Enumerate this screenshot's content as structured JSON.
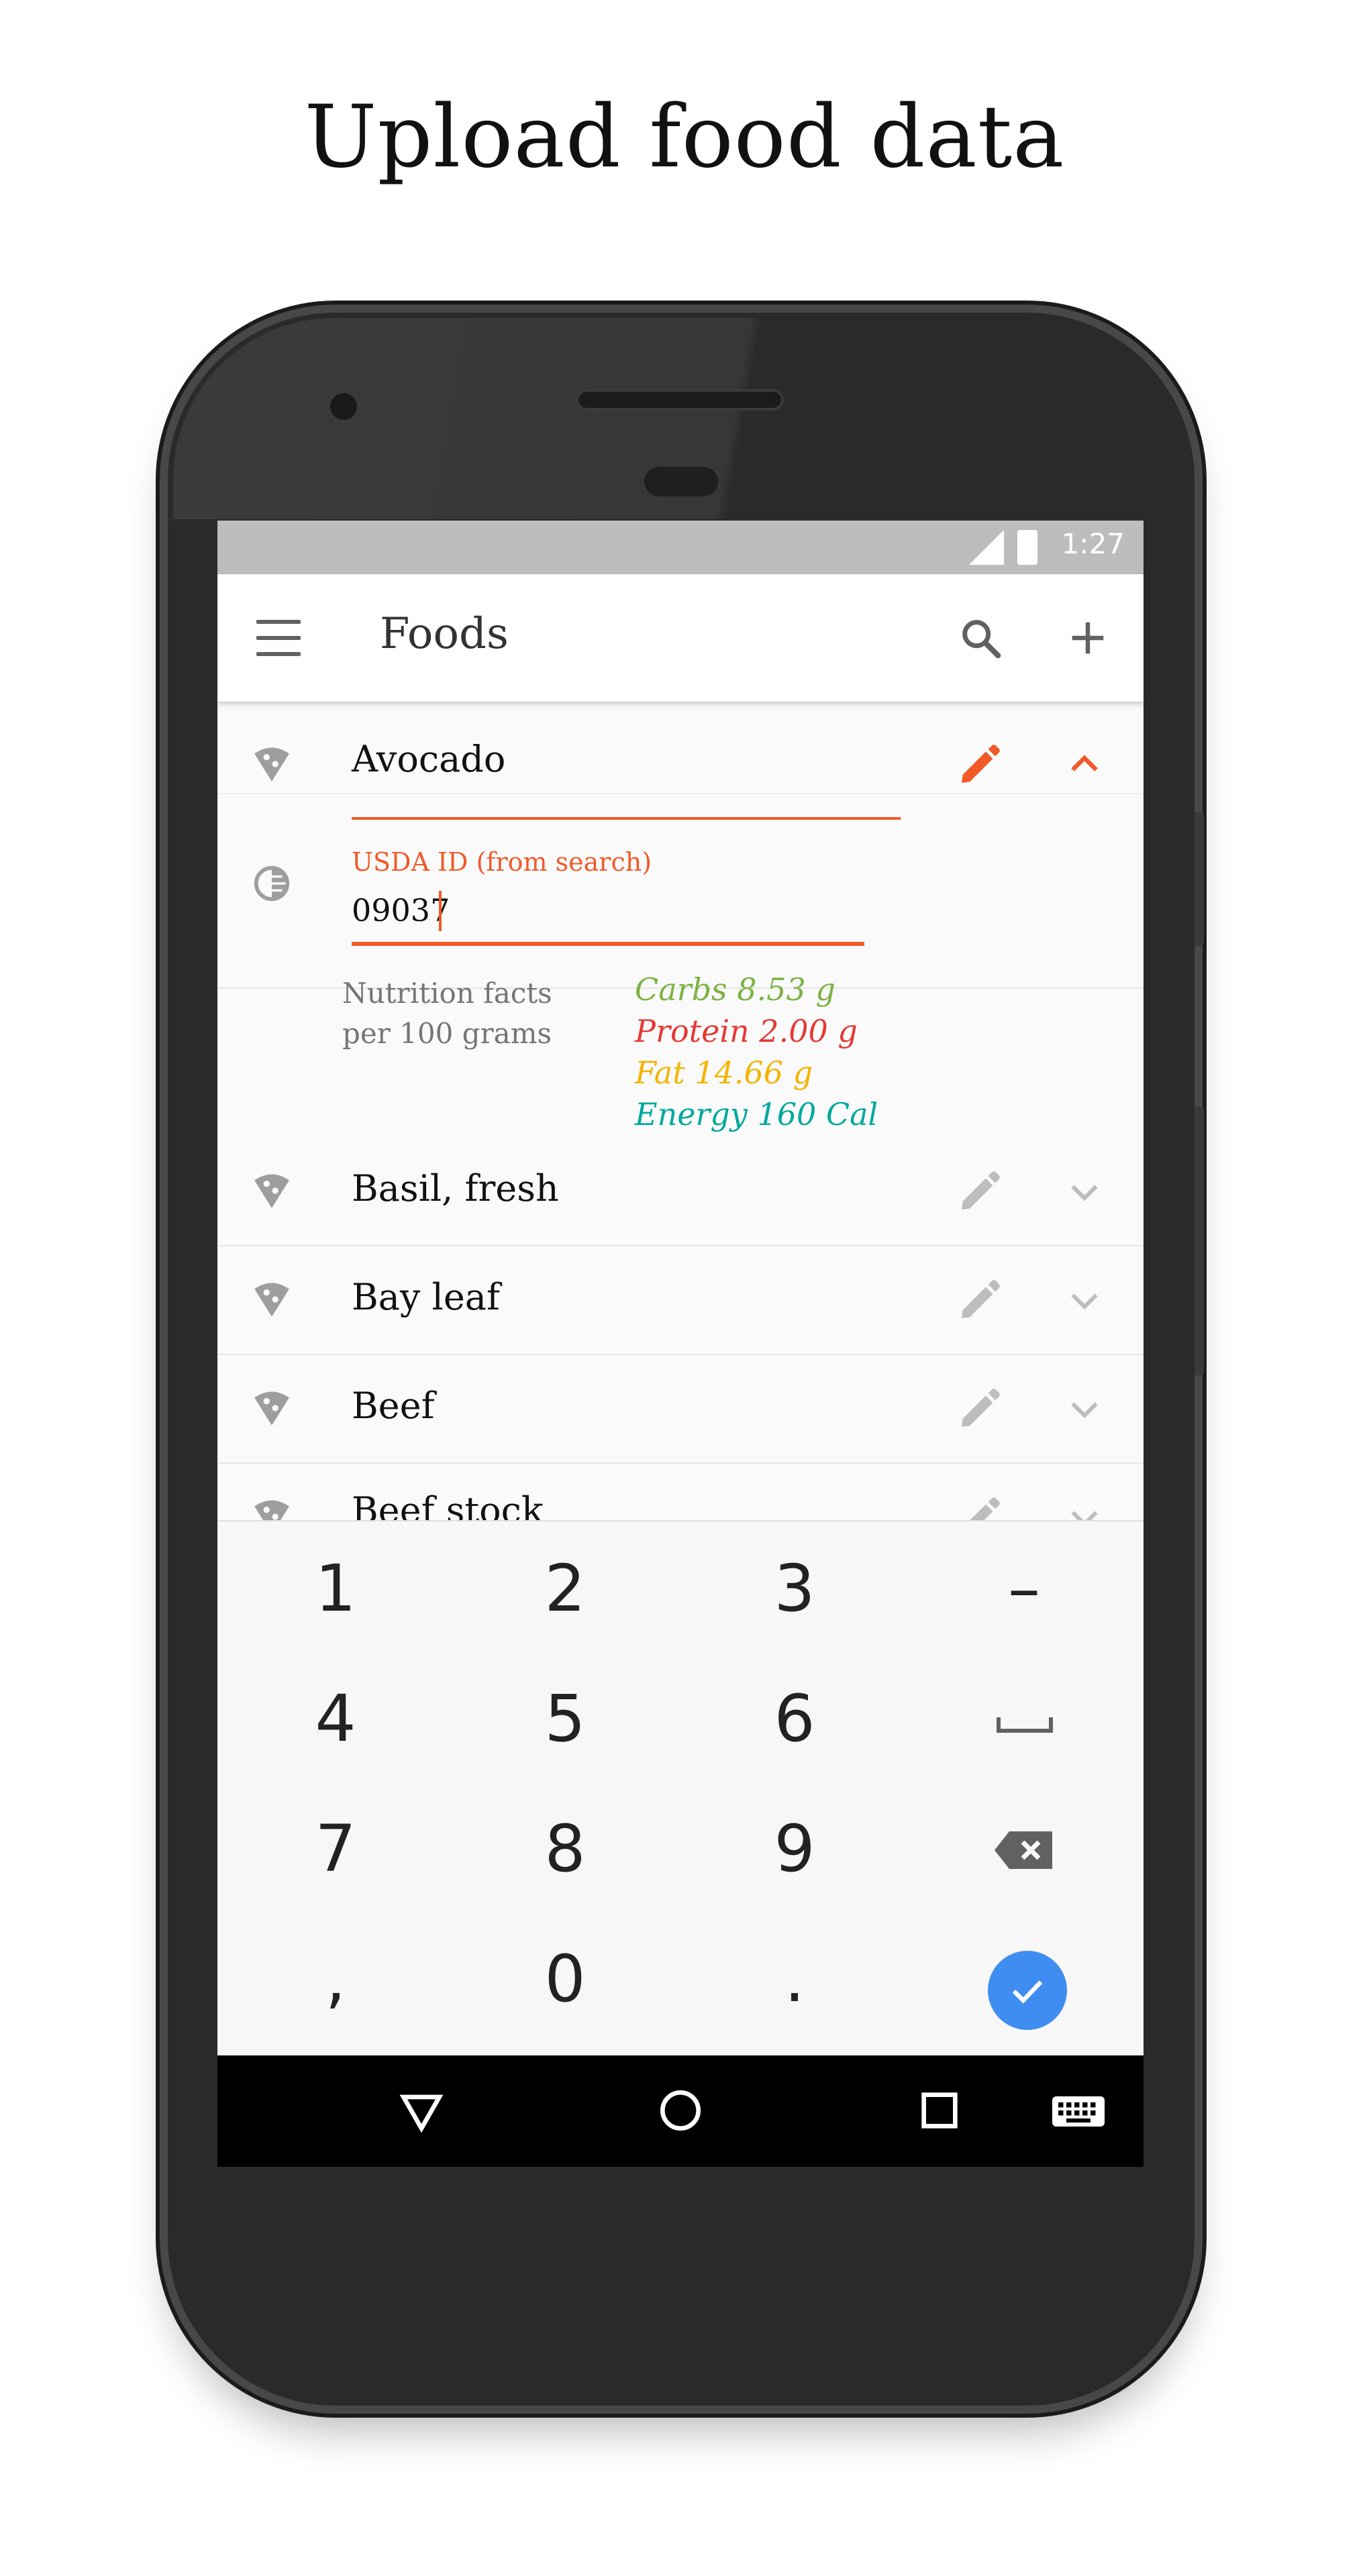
{
  "headline": "Upload food data",
  "status_bar": {
    "time": "1:27",
    "network": "LTE"
  },
  "toolbar": {
    "title": "Foods",
    "icons": [
      "menu-icon",
      "search-icon",
      "add-icon"
    ]
  },
  "expanded_item": {
    "name": "Avocado",
    "usda_label": "USDA ID (from search)",
    "usda_value": "09037",
    "nutrition_label_line1": "Nutrition facts",
    "nutrition_label_line2": "per 100 grams",
    "carbs": "Carbs 8.53 g",
    "protein": "Protein 2.00 g",
    "fat": "Fat 14.66 g",
    "energy": "Energy 160 Cal"
  },
  "food_list": [
    {
      "name": "Basil, fresh"
    },
    {
      "name": "Bay leaf"
    },
    {
      "name": "Beef"
    },
    {
      "name": "Beef stock"
    }
  ],
  "keyboard": {
    "rows": [
      [
        "1",
        "2",
        "3",
        "–"
      ],
      [
        "4",
        "5",
        "6",
        "space"
      ],
      [
        "7",
        "8",
        "9",
        "backspace"
      ],
      [
        ",",
        "0",
        ".",
        "done"
      ]
    ]
  },
  "colors": {
    "accent": "#f05a28",
    "carbs": "#7cb342",
    "protein": "#e53935",
    "fat": "#f4b400",
    "energy": "#00a99d",
    "done_button": "#3f8df0"
  }
}
